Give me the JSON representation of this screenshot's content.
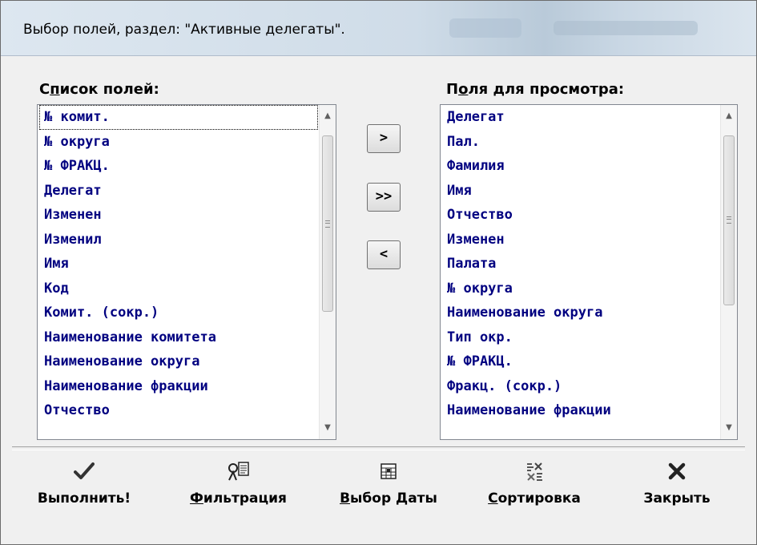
{
  "window": {
    "title": "Выбор полей, раздел: \"Активные делегаты\"."
  },
  "left_list": {
    "label_first": "С",
    "label_mnemonic": "п",
    "label_rest": "исок полей:",
    "items": [
      "№ комит.",
      "№ округа",
      "№ ФРАКЦ.",
      "Делегат",
      "Изменен",
      "Изменил",
      "Имя",
      "Код",
      "Комит. (сокр.)",
      "Наименование комитета",
      "Наименование округа",
      "Наименование фракции",
      "Отчество"
    ]
  },
  "right_list": {
    "label_first": "П",
    "label_mnemonic": "о",
    "label_rest": "ля для просмотра:",
    "items": [
      "Делегат",
      "Пал.",
      "Фамилия",
      "Имя",
      "Отчество",
      "Изменен",
      "Палата",
      "№ округа",
      "Наименование округа",
      "Тип окр.",
      "№ ФРАКЦ.",
      "Фракц. (сокр.)",
      "Наименование фракции"
    ]
  },
  "move_buttons": {
    "add": ">",
    "add_all": ">>",
    "remove": "<"
  },
  "toolbar": {
    "execute": {
      "label": "Выполнить!",
      "icon": "checkmark-icon"
    },
    "filter": {
      "mnemonic": "Ф",
      "rest": "ильтрация",
      "icon": "filter-icon"
    },
    "date": {
      "mnemonic": "В",
      "rest": "ыбор Даты",
      "icon": "calendar-icon"
    },
    "sort": {
      "mnemonic": "С",
      "rest": "ортировка",
      "icon": "sort-icon"
    },
    "close": {
      "label": "Закрыть",
      "icon": "close-x-icon"
    }
  }
}
